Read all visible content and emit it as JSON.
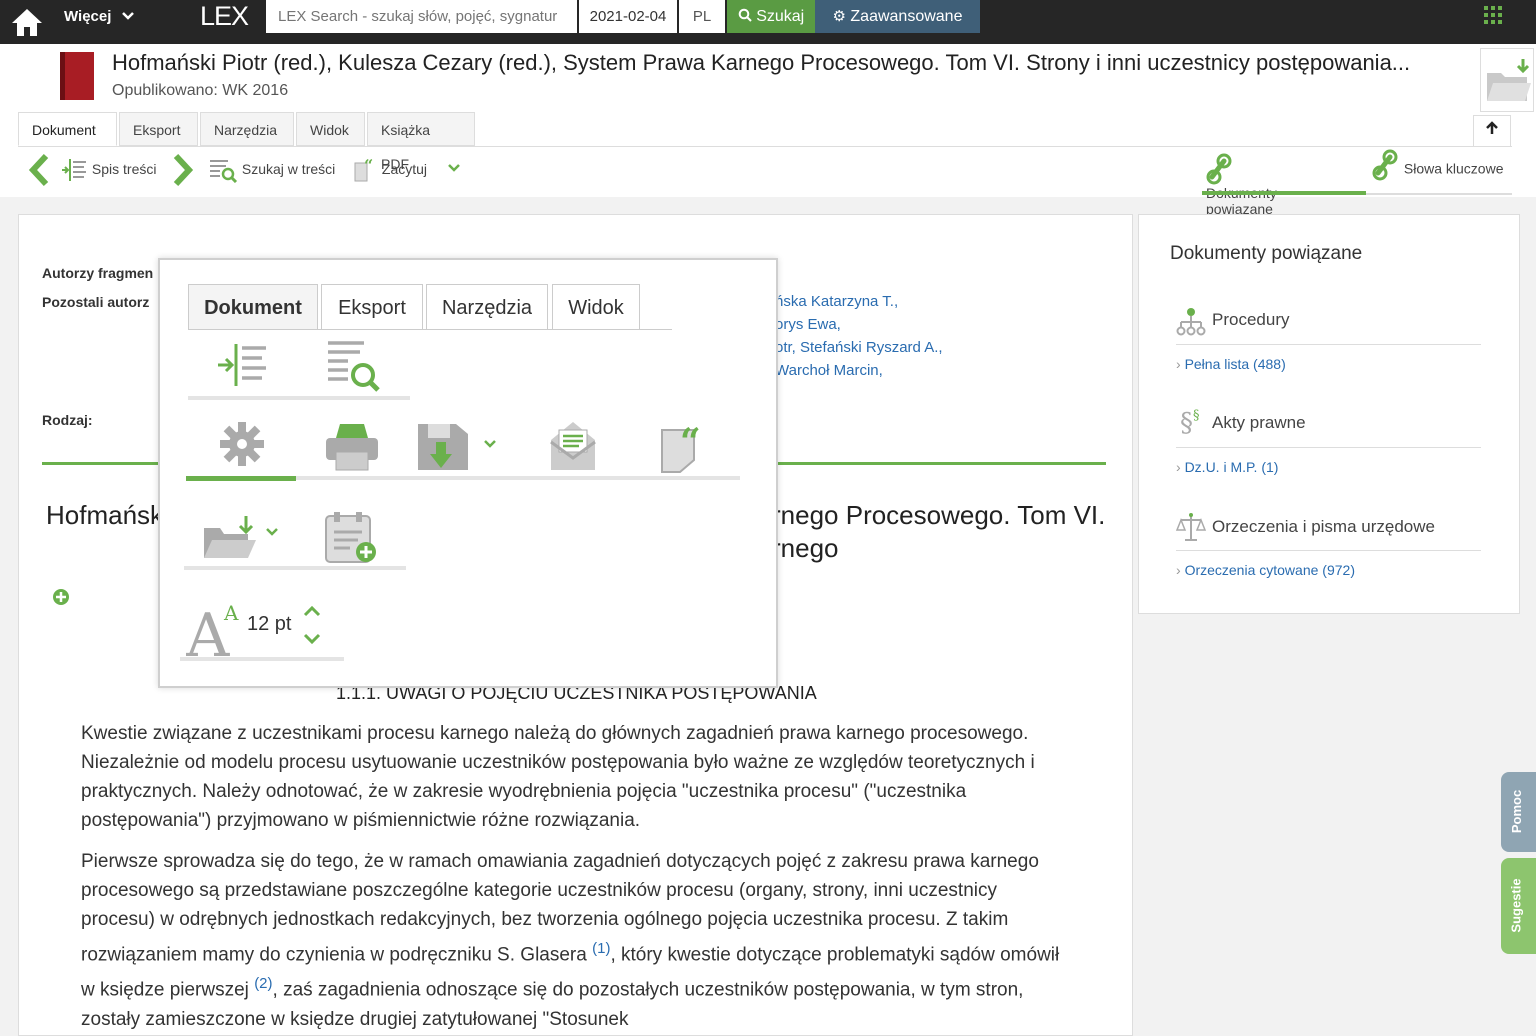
{
  "topbar": {
    "more_label": "Więcej",
    "logo": "LEX",
    "search_placeholder": "LEX Search - szukaj słów, pojęć, sygnatur",
    "date": "2021-02-04",
    "lang": "PL",
    "search_button": "Szukaj",
    "advanced_button": "Zaawansowane"
  },
  "document": {
    "title": "Hofmański Piotr (red.), Kulesza Cezary (red.), System Prawa Karnego Procesowego. Tom VI. Strony i inni uczestnicy postępowania...",
    "published": "Opublikowano: WK 2016"
  },
  "tabs": [
    "Dokument",
    "Eksport",
    "Narzędzia",
    "Widok",
    "Książka PDF"
  ],
  "toolbar": {
    "toc": "Spis treści",
    "search_in": "Szukaj w treści",
    "quote": "Zacytuj",
    "related": "Dokumenty powiązane",
    "keywords": "Słowa kluczowe"
  },
  "main": {
    "authors_label": "Autorzy fragmen",
    "other_authors_label": "Pozostali autorz",
    "authors_links": [
      "ńska Katarzyna T.,",
      "orys Ewa,",
      "otr, Stefański Ryszard A.,",
      "Warchoł Marcin,"
    ],
    "type_label": "Rodzaj:",
    "heading_left": "Hofmańsk",
    "heading_right_1": "rnego Procesowego. Tom VI.",
    "heading_right_2": "rnego",
    "section_title": "1.1.1. UWAGI O POJĘCIU UCZESTNIKA POSTĘPOWANIA",
    "para1": "Kwestie związane z uczestnikami procesu karnego należą do głównych zagadnień prawa karnego procesowego. Niezależnie od modelu procesu usytuowanie uczestników postępowania było ważne ze względów teoretycznych i praktycznych. Należy odnotować, że w zakresie wyodrębnienia pojęcia \"uczestnika procesu\" (\"uczestnika postępowania\") przyjmowano w piśmiennictwie różne rozwiązania.",
    "para2a": "Pierwsze sprowadza się do tego, że w ramach omawiania zagadnień dotyczących pojęć z zakresu prawa karnego procesowego są przedstawiane poszczególne kategorie uczestników procesu (organy, strony, inni uczestnicy procesu) w odrębnych jednostkach redakcyjnych, bez tworzenia ogólnego pojęcia uczestnika procesu. Z takim rozwiązaniem mamy do czynienia w podręczniku S. Glasera",
    "fn1": "(1)",
    "para2b": ", który kwestie dotyczące problematyki sądów omówił w księdze pierwszej",
    "fn2": "(2)",
    "para2c": ", zaś zagadnienia odnoszące się do pozostałych uczestników postępowania, w tym stron, zostały zamieszczone w księdze drugiej zatytułowanej \"Stosunek"
  },
  "sidebar": {
    "title": "Dokumenty powiązane",
    "sections": [
      {
        "name": "Procedury",
        "link": "Pełna lista (488)"
      },
      {
        "name": "Akty prawne",
        "link": "Dz.U. i M.P. (1)"
      },
      {
        "name": "Orzeczenia i pisma urzędowe",
        "link": "Orzeczenia cytowane (972)"
      }
    ]
  },
  "popup": {
    "tabs": [
      "Dokument",
      "Eksport",
      "Narzędzia",
      "Widok"
    ],
    "font_size": "12 pt"
  },
  "sidetabs": {
    "help": "Pomoc",
    "suggestions": "Sugestie"
  },
  "colors": {
    "green": "#6ab04c",
    "dark": "#262626",
    "link": "#2a6cb0",
    "search_btn": "#5a9b43",
    "advanced_btn": "#3f5f78"
  }
}
